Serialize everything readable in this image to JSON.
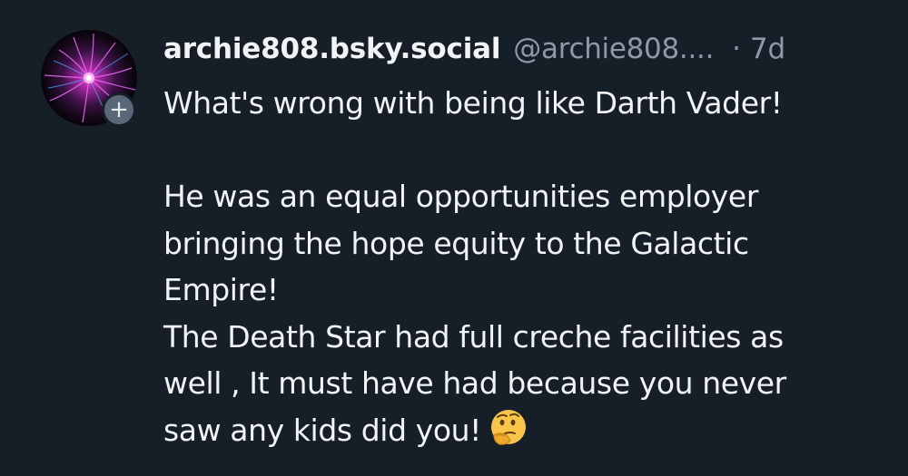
{
  "post": {
    "author": {
      "display_name": "archie808.bsky.social",
      "handle": "@archie808....",
      "avatar_icon": "plasma-ball-avatar",
      "follow_symbol": "+"
    },
    "timestamp": "· 7d",
    "text_lines": [
      "What's wrong with being like Darth Vader!",
      "",
      "He was an equal opportunities employer",
      "bringing the hope equity to the Galactic",
      "Empire!",
      "The Death Star had full creche facilities as",
      "well , It must have had because you never",
      "saw any kids did you!"
    ],
    "trailing_emoji": "thinking-face-emoji"
  },
  "colors": {
    "background": "#161e27",
    "text_primary": "#f1f3f5",
    "text_secondary": "#8d99a8",
    "follow_badge": "#5a6778"
  }
}
